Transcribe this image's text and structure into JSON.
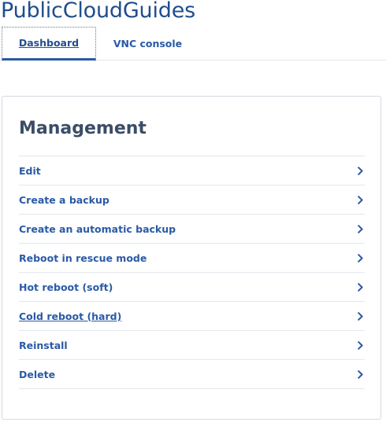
{
  "app": {
    "title": "PublicCloudGuides"
  },
  "tabs": [
    {
      "label": "Dashboard",
      "active": true
    },
    {
      "label": "VNC console",
      "active": false
    }
  ],
  "management": {
    "title": "Management",
    "items": [
      {
        "label": "Edit",
        "icon": "chevron-right-icon"
      },
      {
        "label": "Create a backup",
        "icon": "chevron-right-icon"
      },
      {
        "label": "Create an automatic backup",
        "icon": "chevron-right-icon"
      },
      {
        "label": "Reboot in rescue mode",
        "icon": "chevron-right-icon"
      },
      {
        "label": "Hot reboot (soft)",
        "icon": "chevron-right-icon"
      },
      {
        "label": "Cold reboot (hard)",
        "icon": "chevron-right-icon"
      },
      {
        "label": "Reinstall",
        "icon": "chevron-right-icon"
      },
      {
        "label": "Delete",
        "icon": "chevron-right-icon"
      }
    ]
  },
  "colors": {
    "brand": "#1f4e8c",
    "link": "#2a5aa6",
    "heading": "#3b4d66",
    "divider": "#e3e7ec"
  }
}
